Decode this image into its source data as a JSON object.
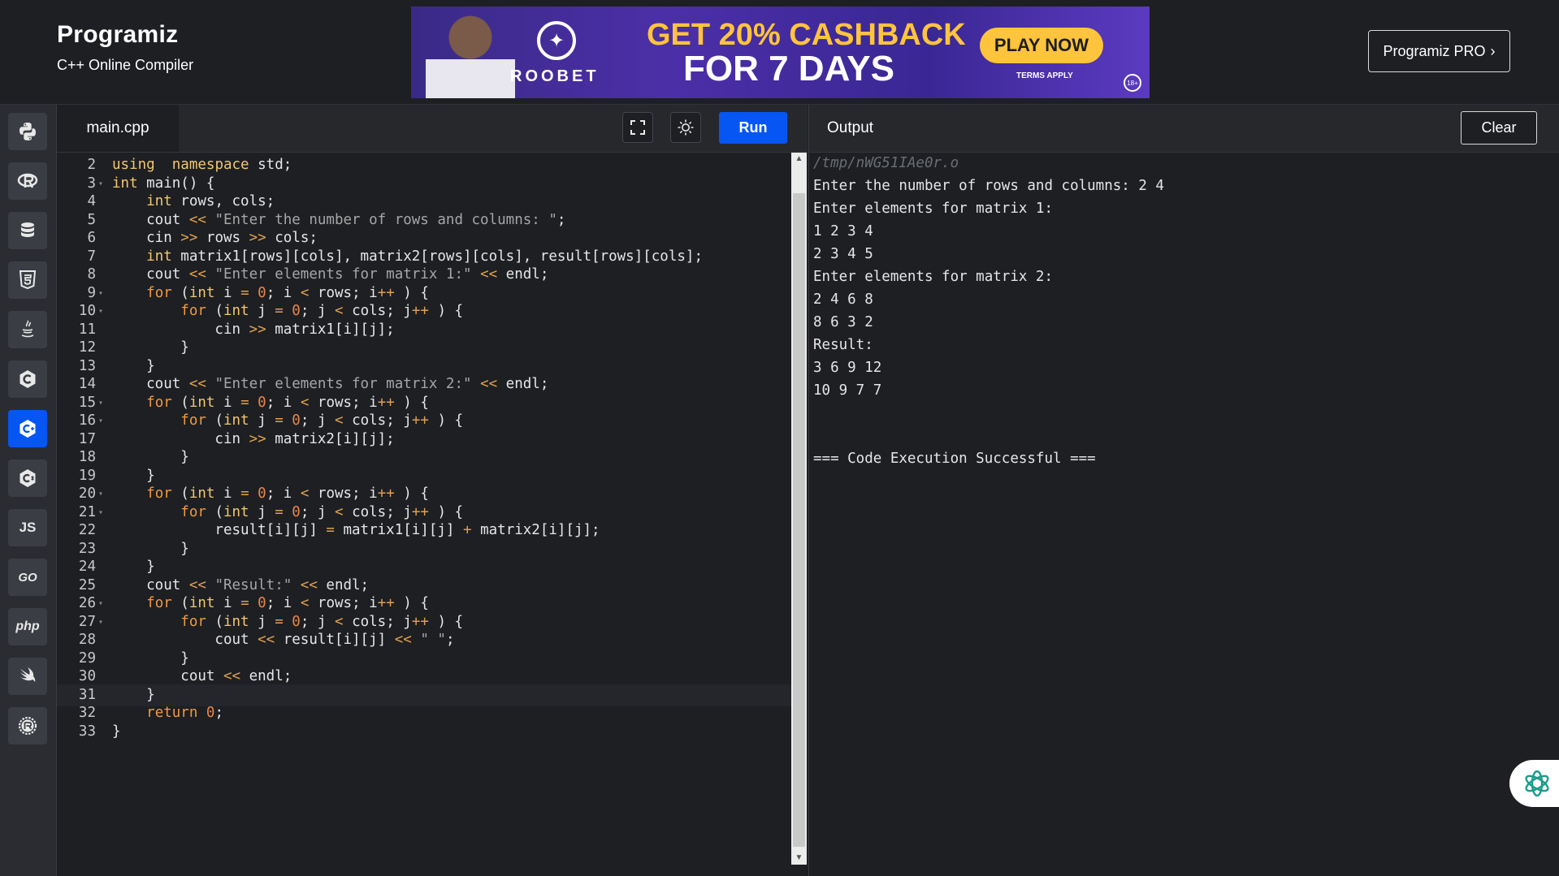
{
  "header": {
    "logo_name": "Programiz",
    "logo_sub": "C++ Online Compiler",
    "pro_button": "Programiz PRO",
    "ad": {
      "brand": "ROOBET",
      "headline1": "GET 20% CASHBACK",
      "headline2": "FOR 7 DAYS",
      "cta": "PLAY NOW",
      "terms": "TERMS APPLY",
      "age": "18+"
    }
  },
  "sidebar": {
    "items": [
      {
        "name": "python",
        "label": ""
      },
      {
        "name": "r",
        "label": ""
      },
      {
        "name": "sql",
        "label": ""
      },
      {
        "name": "html",
        "label": ""
      },
      {
        "name": "java",
        "label": ""
      },
      {
        "name": "c",
        "label": ""
      },
      {
        "name": "cpp",
        "label": "",
        "active": true
      },
      {
        "name": "csharp",
        "label": ""
      },
      {
        "name": "javascript",
        "label": "JS"
      },
      {
        "name": "go",
        "label": "GO"
      },
      {
        "name": "php",
        "label": "php"
      },
      {
        "name": "swift",
        "label": ""
      },
      {
        "name": "rust",
        "label": ""
      }
    ]
  },
  "editor": {
    "filename": "main.cpp",
    "run_label": "Run",
    "lines": [
      {
        "n": "2",
        "fold": false,
        "tokens": [
          [
            "kw",
            "using"
          ],
          [
            "",
            "  "
          ],
          [
            "kw",
            "namespace"
          ],
          [
            "",
            " std;"
          ]
        ]
      },
      {
        "n": "3",
        "fold": true,
        "tokens": [
          [
            "kw",
            "int"
          ],
          [
            "",
            " main() {"
          ]
        ]
      },
      {
        "n": "4",
        "fold": false,
        "tokens": [
          [
            "",
            "    "
          ],
          [
            "kw",
            "int"
          ],
          [
            "",
            " rows, cols;"
          ]
        ]
      },
      {
        "n": "5",
        "fold": false,
        "tokens": [
          [
            "",
            "    cout "
          ],
          [
            "op",
            "<<"
          ],
          [
            "str",
            " \"Enter the number of rows and columns: \""
          ],
          [
            "",
            ";"
          ]
        ]
      },
      {
        "n": "6",
        "fold": false,
        "tokens": [
          [
            "",
            "    cin "
          ],
          [
            "op",
            ">>"
          ],
          [
            "",
            " rows "
          ],
          [
            "op",
            ">>"
          ],
          [
            "",
            " cols;"
          ]
        ]
      },
      {
        "n": "7",
        "fold": false,
        "tokens": [
          [
            "",
            "    "
          ],
          [
            "kw",
            "int"
          ],
          [
            "",
            " matrix1[rows][cols], matrix2[rows][cols], result[rows][cols];"
          ]
        ]
      },
      {
        "n": "8",
        "fold": false,
        "tokens": [
          [
            "",
            "    cout "
          ],
          [
            "op",
            "<<"
          ],
          [
            "str",
            " \"Enter elements for matrix 1:\""
          ],
          [
            "op",
            " <<"
          ],
          [
            "",
            " endl;"
          ]
        ]
      },
      {
        "n": "9",
        "fold": true,
        "tokens": [
          [
            "",
            "    "
          ],
          [
            "kw2",
            "for"
          ],
          [
            "",
            " ("
          ],
          [
            "kw",
            "int"
          ],
          [
            "",
            " i "
          ],
          [
            "op",
            "="
          ],
          [
            "num",
            " 0"
          ],
          [
            "",
            ";"
          ],
          [
            "",
            " i "
          ],
          [
            "op",
            "<"
          ],
          [
            "",
            " rows; i"
          ],
          [
            "op",
            "++"
          ],
          [
            "",
            " ) {"
          ]
        ]
      },
      {
        "n": "10",
        "fold": true,
        "tokens": [
          [
            "",
            "        "
          ],
          [
            "kw2",
            "for"
          ],
          [
            "",
            " ("
          ],
          [
            "kw",
            "int"
          ],
          [
            "",
            " j "
          ],
          [
            "op",
            "="
          ],
          [
            "num",
            " 0"
          ],
          [
            "",
            ";"
          ],
          [
            "",
            " j "
          ],
          [
            "op",
            "<"
          ],
          [
            "",
            " cols; j"
          ],
          [
            "op",
            "++"
          ],
          [
            "",
            " ) {"
          ]
        ]
      },
      {
        "n": "11",
        "fold": false,
        "tokens": [
          [
            "",
            "            cin "
          ],
          [
            "op",
            ">>"
          ],
          [
            "",
            " matrix1[i][j];"
          ]
        ]
      },
      {
        "n": "12",
        "fold": false,
        "tokens": [
          [
            "",
            "        }"
          ]
        ]
      },
      {
        "n": "13",
        "fold": false,
        "tokens": [
          [
            "",
            "    }"
          ]
        ]
      },
      {
        "n": "14",
        "fold": false,
        "tokens": [
          [
            "",
            "    cout "
          ],
          [
            "op",
            "<<"
          ],
          [
            "str",
            " \"Enter elements for matrix 2:\""
          ],
          [
            "op",
            " <<"
          ],
          [
            "",
            " endl;"
          ]
        ]
      },
      {
        "n": "15",
        "fold": true,
        "tokens": [
          [
            "",
            "    "
          ],
          [
            "kw2",
            "for"
          ],
          [
            "",
            " ("
          ],
          [
            "kw",
            "int"
          ],
          [
            "",
            " i "
          ],
          [
            "op",
            "="
          ],
          [
            "num",
            " 0"
          ],
          [
            "",
            ";"
          ],
          [
            "",
            " i "
          ],
          [
            "op",
            "<"
          ],
          [
            "",
            " rows; i"
          ],
          [
            "op",
            "++"
          ],
          [
            "",
            " ) {"
          ]
        ]
      },
      {
        "n": "16",
        "fold": true,
        "tokens": [
          [
            "",
            "        "
          ],
          [
            "kw2",
            "for"
          ],
          [
            "",
            " ("
          ],
          [
            "kw",
            "int"
          ],
          [
            "",
            " j "
          ],
          [
            "op",
            "="
          ],
          [
            "num",
            " 0"
          ],
          [
            "",
            ";"
          ],
          [
            "",
            " j "
          ],
          [
            "op",
            "<"
          ],
          [
            "",
            " cols; j"
          ],
          [
            "op",
            "++"
          ],
          [
            "",
            " ) {"
          ]
        ]
      },
      {
        "n": "17",
        "fold": false,
        "tokens": [
          [
            "",
            "            cin "
          ],
          [
            "op",
            ">>"
          ],
          [
            "",
            " matrix2[i][j];"
          ]
        ]
      },
      {
        "n": "18",
        "fold": false,
        "tokens": [
          [
            "",
            "        }"
          ]
        ]
      },
      {
        "n": "19",
        "fold": false,
        "tokens": [
          [
            "",
            "    }"
          ]
        ]
      },
      {
        "n": "20",
        "fold": true,
        "tokens": [
          [
            "",
            "    "
          ],
          [
            "kw2",
            "for"
          ],
          [
            "",
            " ("
          ],
          [
            "kw",
            "int"
          ],
          [
            "",
            " i "
          ],
          [
            "op",
            "="
          ],
          [
            "num",
            " 0"
          ],
          [
            "",
            ";"
          ],
          [
            "",
            " i "
          ],
          [
            "op",
            "<"
          ],
          [
            "",
            " rows; i"
          ],
          [
            "op",
            "++"
          ],
          [
            "",
            " ) {"
          ]
        ]
      },
      {
        "n": "21",
        "fold": true,
        "tokens": [
          [
            "",
            "        "
          ],
          [
            "kw2",
            "for"
          ],
          [
            "",
            " ("
          ],
          [
            "kw",
            "int"
          ],
          [
            "",
            " j "
          ],
          [
            "op",
            "="
          ],
          [
            "num",
            " 0"
          ],
          [
            "",
            ";"
          ],
          [
            "",
            " j "
          ],
          [
            "op",
            "<"
          ],
          [
            "",
            " cols; j"
          ],
          [
            "op",
            "++"
          ],
          [
            "",
            " ) {"
          ]
        ]
      },
      {
        "n": "22",
        "fold": false,
        "tokens": [
          [
            "",
            "            result[i][j] "
          ],
          [
            "op",
            "="
          ],
          [
            "",
            " matrix1[i][j] "
          ],
          [
            "op",
            "+"
          ],
          [
            "",
            " matrix2[i][j];"
          ]
        ]
      },
      {
        "n": "23",
        "fold": false,
        "tokens": [
          [
            "",
            "        }"
          ]
        ]
      },
      {
        "n": "24",
        "fold": false,
        "tokens": [
          [
            "",
            "    }"
          ]
        ]
      },
      {
        "n": "25",
        "fold": false,
        "tokens": [
          [
            "",
            "    cout "
          ],
          [
            "op",
            "<<"
          ],
          [
            "str",
            " \"Result:\""
          ],
          [
            "op",
            " <<"
          ],
          [
            "",
            " endl;"
          ]
        ]
      },
      {
        "n": "26",
        "fold": true,
        "tokens": [
          [
            "",
            "    "
          ],
          [
            "kw2",
            "for"
          ],
          [
            "",
            " ("
          ],
          [
            "kw",
            "int"
          ],
          [
            "",
            " i "
          ],
          [
            "op",
            "="
          ],
          [
            "num",
            " 0"
          ],
          [
            "",
            ";"
          ],
          [
            "",
            " i "
          ],
          [
            "op",
            "<"
          ],
          [
            "",
            " rows; i"
          ],
          [
            "op",
            "++"
          ],
          [
            "",
            " ) {"
          ]
        ]
      },
      {
        "n": "27",
        "fold": true,
        "tokens": [
          [
            "",
            "        "
          ],
          [
            "kw2",
            "for"
          ],
          [
            "",
            " ("
          ],
          [
            "kw",
            "int"
          ],
          [
            "",
            " j "
          ],
          [
            "op",
            "="
          ],
          [
            "num",
            " 0"
          ],
          [
            "",
            ";"
          ],
          [
            "",
            " j "
          ],
          [
            "op",
            "<"
          ],
          [
            "",
            " cols; j"
          ],
          [
            "op",
            "++"
          ],
          [
            "",
            " ) {"
          ]
        ]
      },
      {
        "n": "28",
        "fold": false,
        "tokens": [
          [
            "",
            "            cout "
          ],
          [
            "op",
            "<<"
          ],
          [
            "",
            " result[i][j] "
          ],
          [
            "op",
            "<<"
          ],
          [
            "str",
            " \" \""
          ],
          [
            "",
            ";"
          ]
        ]
      },
      {
        "n": "29",
        "fold": false,
        "tokens": [
          [
            "",
            "        }"
          ]
        ]
      },
      {
        "n": "30",
        "fold": false,
        "tokens": [
          [
            "",
            "        cout "
          ],
          [
            "op",
            "<<"
          ],
          [
            "",
            " endl;"
          ]
        ]
      },
      {
        "n": "31",
        "fold": false,
        "current": true,
        "tokens": [
          [
            "",
            "    }"
          ]
        ]
      },
      {
        "n": "32",
        "fold": false,
        "tokens": [
          [
            "",
            "    "
          ],
          [
            "kw2",
            "return"
          ],
          [
            "num",
            " 0"
          ],
          [
            "",
            ";"
          ]
        ]
      },
      {
        "n": "33",
        "fold": false,
        "tokens": [
          [
            "",
            "}"
          ]
        ]
      }
    ]
  },
  "output": {
    "title": "Output",
    "clear_label": "Clear",
    "lines": [
      {
        "text": "/tmp/nWG51IAe0r.o",
        "kind": "path"
      },
      {
        "text": "Enter the number of rows and columns: 2 4"
      },
      {
        "text": "Enter elements for matrix 1:"
      },
      {
        "text": "1 2 3 4"
      },
      {
        "text": "2 3 4 5"
      },
      {
        "text": "Enter elements for matrix 2:"
      },
      {
        "text": "2 4 6 8"
      },
      {
        "text": "8 6 3 2"
      },
      {
        "text": "Result:"
      },
      {
        "text": "3 6 9 12"
      },
      {
        "text": "10 9 7 7"
      },
      {
        "text": ""
      },
      {
        "text": ""
      },
      {
        "text": "=== Code Execution Successful ==="
      }
    ]
  },
  "colors": {
    "accent": "#0556f3",
    "background": "#1d1f23",
    "sidebar": "#2a2c31",
    "ad_cashback": "#ffc43d"
  }
}
